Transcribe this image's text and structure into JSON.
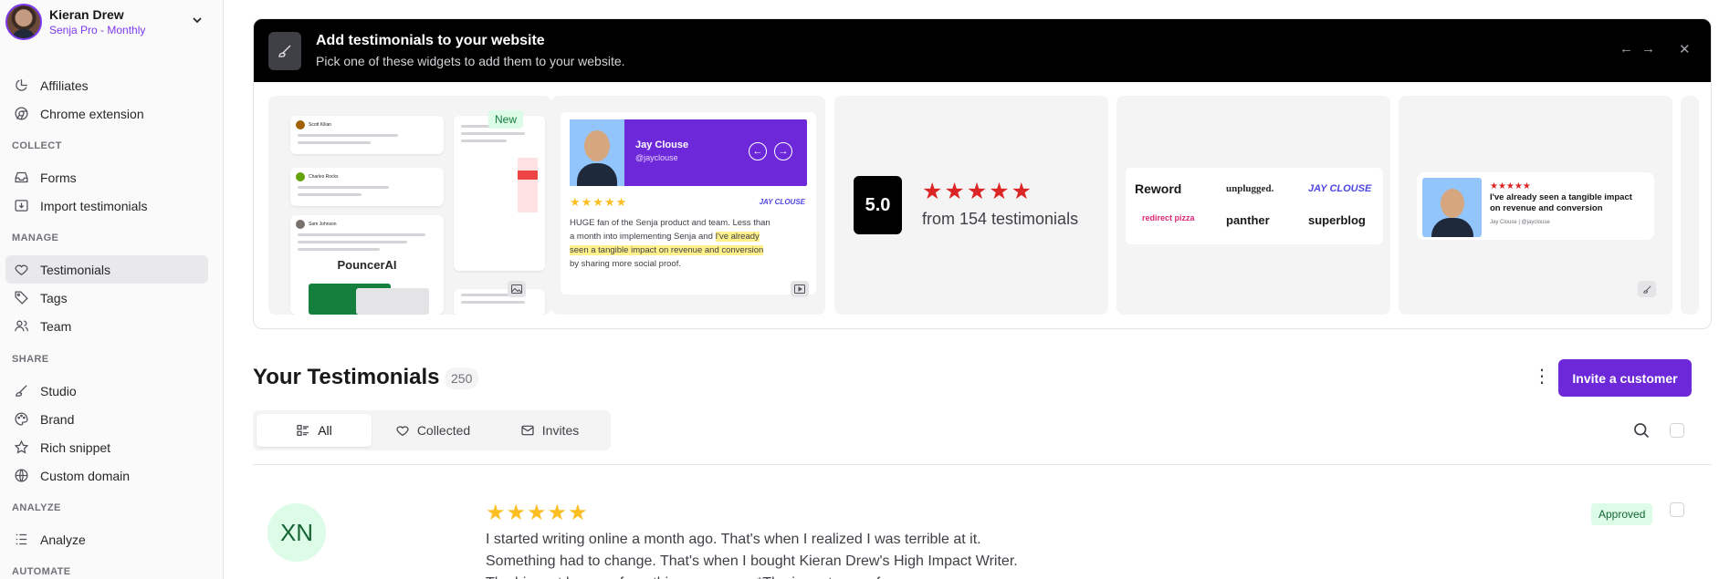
{
  "profile": {
    "name": "Kieran Drew",
    "plan": "Senja Pro - Monthly"
  },
  "sidebar": {
    "top_items": [
      {
        "label": "Affiliates",
        "icon": "chart-pie-icon"
      },
      {
        "label": "Chrome extension",
        "icon": "chrome-icon"
      }
    ],
    "sections": [
      {
        "label": "COLLECT",
        "items": [
          {
            "label": "Forms",
            "icon": "inbox-icon"
          },
          {
            "label": "Import testimonials",
            "icon": "import-icon"
          }
        ]
      },
      {
        "label": "MANAGE",
        "items": [
          {
            "label": "Testimonials",
            "icon": "heart-icon",
            "active": true
          },
          {
            "label": "Tags",
            "icon": "tag-icon"
          },
          {
            "label": "Team",
            "icon": "users-icon"
          }
        ]
      },
      {
        "label": "SHARE",
        "items": [
          {
            "label": "Studio",
            "icon": "brush-icon"
          },
          {
            "label": "Brand",
            "icon": "palette-icon"
          },
          {
            "label": "Rich snippet",
            "icon": "star-icon"
          },
          {
            "label": "Custom domain",
            "icon": "globe-icon"
          }
        ]
      },
      {
        "label": "ANALYZE",
        "items": [
          {
            "label": "Analyze",
            "icon": "analyze-icon"
          }
        ]
      },
      {
        "label": "AUTOMATE",
        "items": []
      }
    ]
  },
  "widgets": {
    "title": "Add testimonials to your website",
    "subtitle": "Pick one of these widgets to add them to your website.",
    "new_badge": "New",
    "card2": {
      "name": "Jay Clouse",
      "handle": "@jayclouse",
      "logo": "JAY CLOUSE",
      "text_before": "HUGE fan of the Senja product and team. Less than a month into implementing Senja and ",
      "text_highlight": "I've already seen a tangible impact on revenue and conversion",
      "text_after": " by sharing more social proof."
    },
    "card3": {
      "score": "5.0",
      "sub": "from 154 testimonials"
    },
    "card4": {
      "logos": [
        "Reword",
        "unplugged.",
        "JAY CLOUSE",
        "redirect pizza",
        "panther",
        "superblog"
      ]
    },
    "card5": {
      "text": "I've already seen a tangible impact on revenue and conversion",
      "by": "Jay Clouse | @jayclouse"
    },
    "wall": {
      "names": [
        "Scott Kilian",
        "Charles Rocks",
        "Sam Johnson"
      ],
      "brand": "PouncerAI"
    }
  },
  "testimonials": {
    "title": "Your Testimonials",
    "count": "250",
    "invite_label": "Invite a customer",
    "tabs": [
      {
        "label": "All",
        "icon": "list-icon",
        "active": true
      },
      {
        "label": "Collected",
        "icon": "heart-icon"
      },
      {
        "label": "Invites",
        "icon": "mail-icon"
      }
    ],
    "row": {
      "initials": "XN",
      "status": "Approved",
      "text": "I started writing online a month ago. That's when I realized I was terrible at it. Something had to change. That's when I bought Kieran Drew's High Impact Writer. The biggest lessons from this course are: *The importance of"
    }
  }
}
